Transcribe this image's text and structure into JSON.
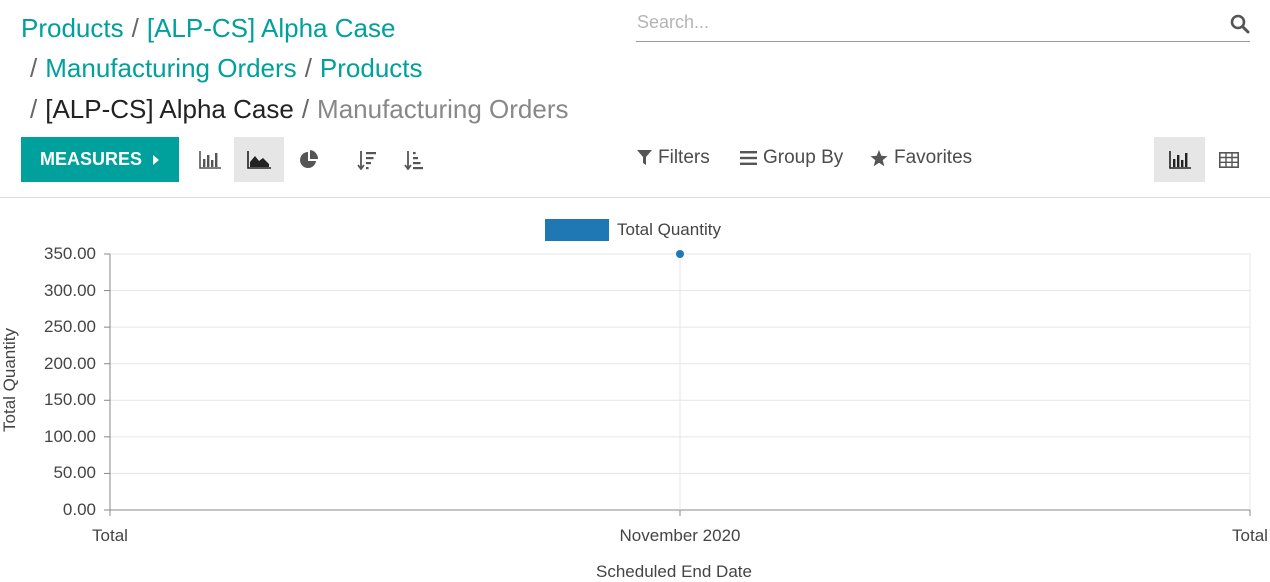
{
  "breadcrumb": {
    "items": [
      "Products",
      "[ALP-CS] Alpha Case",
      "Manufacturing Orders",
      "Products",
      "[ALP-CS] Alpha Case",
      "Manufacturing Orders"
    ],
    "separator": "/"
  },
  "search": {
    "placeholder": "Search..."
  },
  "toolbar": {
    "measures_label": "MEASURES",
    "filters_label": "Filters",
    "groupby_label": "Group By",
    "favorites_label": "Favorites"
  },
  "colors": {
    "accent": "#00a09d",
    "series": "#1f77b4"
  },
  "chart_data": {
    "type": "line",
    "legend": [
      "Total Quantity"
    ],
    "ylabel": "Total Quantity",
    "xlabel": "Scheduled End Date",
    "x_ticks": [
      "Total",
      "November 2020",
      "Total"
    ],
    "y_ticks": [
      "350.00",
      "300.00",
      "250.00",
      "200.00",
      "150.00",
      "100.00",
      "50.00",
      "0.00"
    ],
    "ylim": [
      0,
      350
    ],
    "series": [
      {
        "name": "Total Quantity",
        "x": [
          "November 2020"
        ],
        "values": [
          350
        ]
      }
    ]
  }
}
